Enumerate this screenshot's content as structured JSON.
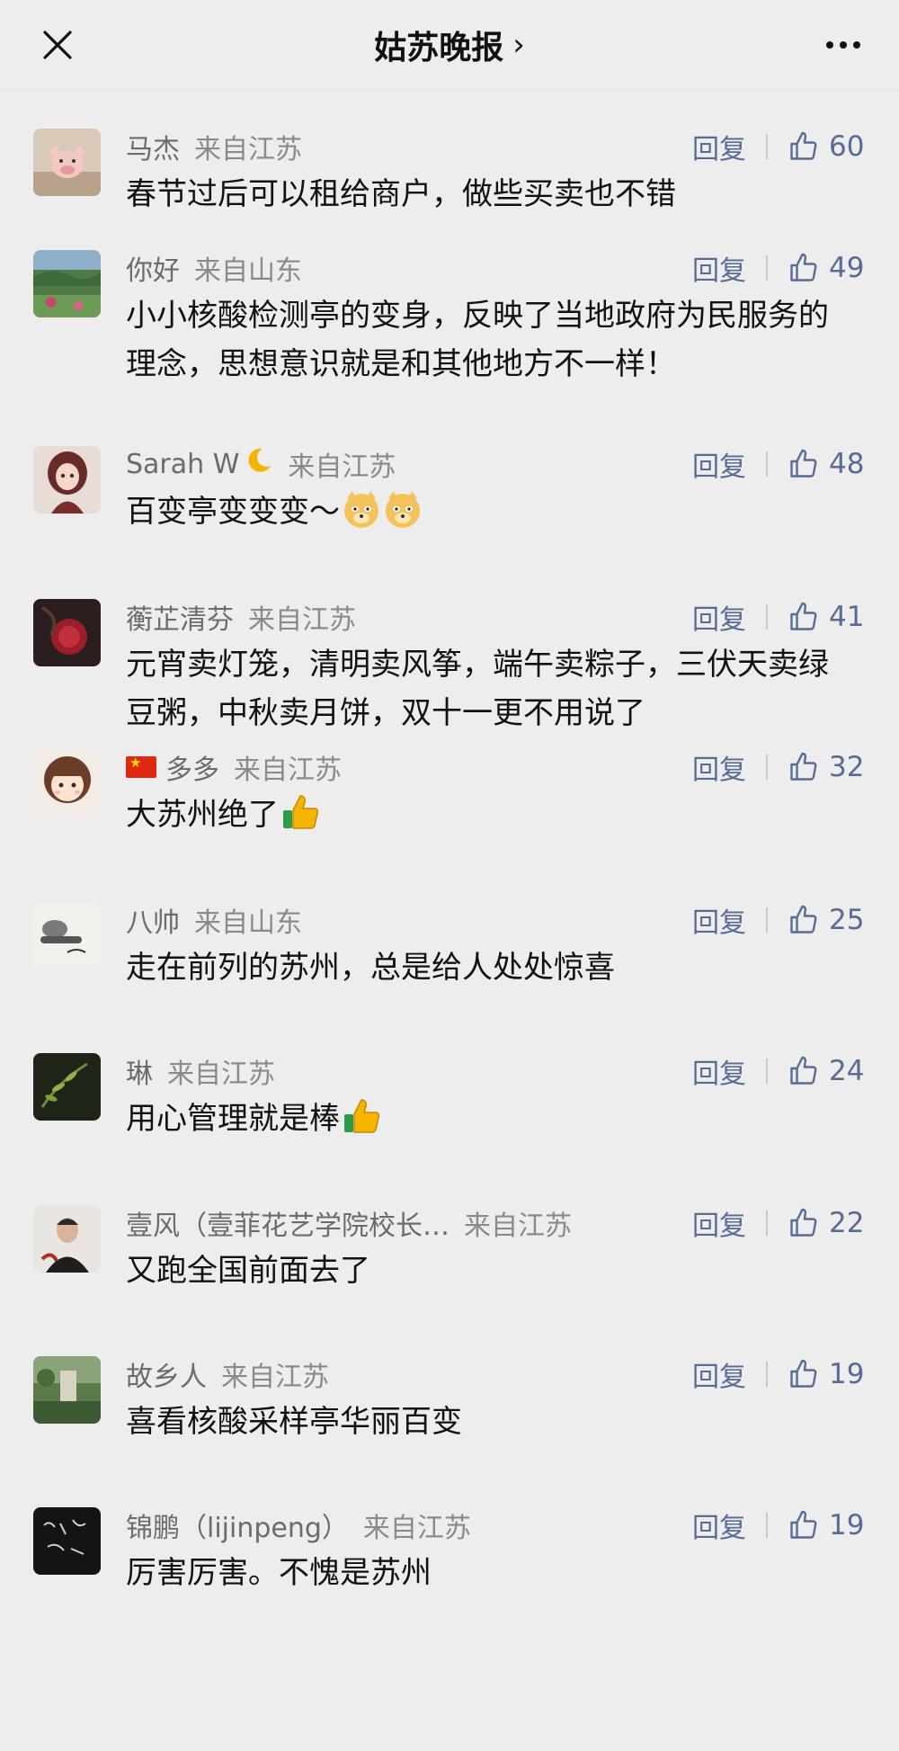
{
  "header": {
    "title": "姑苏晚报",
    "chevron": "›",
    "close_icon": "close-icon",
    "more_icon": "more-icon"
  },
  "colors": {
    "background": "#ededed",
    "link": "#576b95",
    "meta": "#888888",
    "text": "#111111"
  },
  "comments": [
    {
      "name": "马杰",
      "location": "来自江苏",
      "reply": "回复",
      "likes": "60",
      "text": "春节过后可以租给商户，做些买卖也不错",
      "avatar": "pig-toy-avatar"
    },
    {
      "name": "你好",
      "location": "来自山东",
      "reply": "回复",
      "likes": "49",
      "text": "小小核酸检测亭的变身，反映了当地政府为民服务的理念，思想意识就是和其他地方不一样！",
      "avatar": "landscape-avatar"
    },
    {
      "name": "Sarah W",
      "location": "来自江苏",
      "reply": "回复",
      "likes": "48",
      "text": "百变亭变变变～",
      "avatar": "doll-avatar",
      "name_emoji": "crescent-moon-emoji",
      "text_emoji": "doge-emoji"
    },
    {
      "name": "蘅芷清芬",
      "location": "来自江苏",
      "reply": "回复",
      "likes": "41",
      "text": "元宵卖灯笼，清明卖风筝，端午卖粽子，三伏天卖绿豆粥，中秋卖月饼，双十一更不用说了",
      "avatar": "dark-portrait-avatar"
    },
    {
      "name": "多多",
      "location": "来自江苏",
      "reply": "回复",
      "likes": "32",
      "text": "大苏州绝了",
      "avatar": "cartoon-girl-avatar",
      "name_emoji": "china-flag-emoji",
      "text_emoji": "thumbs-up-emoji"
    },
    {
      "name": "八帅",
      "location": "来自山东",
      "reply": "回复",
      "likes": "25",
      "text": "走在前列的苏州，总是给人处处惊喜",
      "avatar": "sketch-avatar"
    },
    {
      "name": "琳",
      "location": "来自江苏",
      "reply": "回复",
      "likes": "24",
      "text": "用心管理就是棒",
      "avatar": "plant-avatar",
      "text_emoji": "thumbs-up-emoji"
    },
    {
      "name": "壹风（壹菲花艺学院校长…",
      "location": "来自江苏",
      "reply": "回复",
      "likes": "22",
      "text": "又跑全国前面去了",
      "avatar": "man-portrait-avatar"
    },
    {
      "name": "故乡人",
      "location": "来自江苏",
      "reply": "回复",
      "likes": "19",
      "text": "喜看核酸采样亭华丽百变",
      "avatar": "garden-avatar"
    },
    {
      "name": "锦鹏（lijinpeng）",
      "location": "来自江苏",
      "reply": "回复",
      "likes": "19",
      "text": "厉害厉害。不愧是苏州",
      "avatar": "calligraphy-avatar"
    }
  ]
}
